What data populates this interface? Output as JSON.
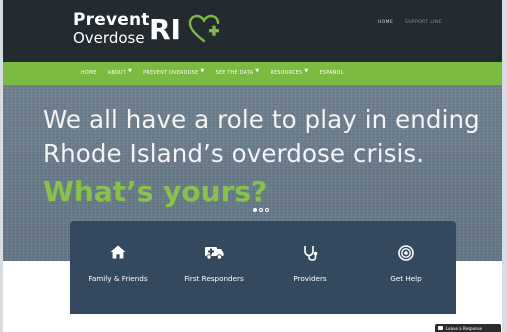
{
  "logo": {
    "line1": "Prevent",
    "line2": "Overdose",
    "mark": "RI",
    "icon": "heart-plus-icon"
  },
  "top_links": [
    "HOME",
    "SUPPORT LINE"
  ],
  "nav": [
    {
      "label": "HOME",
      "has_dropdown": false
    },
    {
      "label": "ABOUT",
      "has_dropdown": true
    },
    {
      "label": "PREVENT OVERDOSE",
      "has_dropdown": true
    },
    {
      "label": "SEE THE DATA",
      "has_dropdown": true
    },
    {
      "label": "RESOURCES",
      "has_dropdown": true
    },
    {
      "label": "ESPAÑOL",
      "has_dropdown": false
    }
  ],
  "hero": {
    "line1": "We all have a role to play in ending",
    "line2": "Rhode Island’s overdose crisis.",
    "cta": "What’s yours?",
    "slides": 3,
    "active_slide": 1
  },
  "actions": [
    {
      "label": "Family & Friends",
      "icon": "home-icon"
    },
    {
      "label": "First Responders",
      "icon": "ambulance-icon"
    },
    {
      "label": "Providers",
      "icon": "stethoscope-icon"
    },
    {
      "label": "Get Help",
      "icon": "target-icon"
    }
  ],
  "feedback": {
    "label": "Leave a Response"
  },
  "colors": {
    "header_bg": "#232a30",
    "nav_green": "#7cbb42",
    "cta_green": "#8ac14a",
    "panel_bg": "#34495e"
  }
}
